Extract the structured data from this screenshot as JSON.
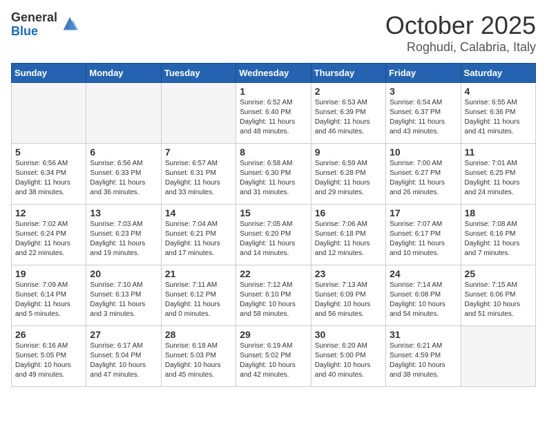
{
  "header": {
    "logo_general": "General",
    "logo_blue": "Blue",
    "month_title": "October 2025",
    "location": "Roghudi, Calabria, Italy"
  },
  "weekdays": [
    "Sunday",
    "Monday",
    "Tuesday",
    "Wednesday",
    "Thursday",
    "Friday",
    "Saturday"
  ],
  "weeks": [
    [
      {
        "day": "",
        "empty": true
      },
      {
        "day": "",
        "empty": true
      },
      {
        "day": "",
        "empty": true
      },
      {
        "day": "1",
        "sunrise": "6:52 AM",
        "sunset": "6:40 PM",
        "daylight": "11 hours and 48 minutes."
      },
      {
        "day": "2",
        "sunrise": "6:53 AM",
        "sunset": "6:39 PM",
        "daylight": "11 hours and 46 minutes."
      },
      {
        "day": "3",
        "sunrise": "6:54 AM",
        "sunset": "6:37 PM",
        "daylight": "11 hours and 43 minutes."
      },
      {
        "day": "4",
        "sunrise": "6:55 AM",
        "sunset": "6:36 PM",
        "daylight": "11 hours and 41 minutes."
      }
    ],
    [
      {
        "day": "5",
        "sunrise": "6:56 AM",
        "sunset": "6:34 PM",
        "daylight": "11 hours and 38 minutes."
      },
      {
        "day": "6",
        "sunrise": "6:56 AM",
        "sunset": "6:33 PM",
        "daylight": "11 hours and 36 minutes."
      },
      {
        "day": "7",
        "sunrise": "6:57 AM",
        "sunset": "6:31 PM",
        "daylight": "11 hours and 33 minutes."
      },
      {
        "day": "8",
        "sunrise": "6:58 AM",
        "sunset": "6:30 PM",
        "daylight": "11 hours and 31 minutes."
      },
      {
        "day": "9",
        "sunrise": "6:59 AM",
        "sunset": "6:28 PM",
        "daylight": "11 hours and 29 minutes."
      },
      {
        "day": "10",
        "sunrise": "7:00 AM",
        "sunset": "6:27 PM",
        "daylight": "11 hours and 26 minutes."
      },
      {
        "day": "11",
        "sunrise": "7:01 AM",
        "sunset": "6:25 PM",
        "daylight": "11 hours and 24 minutes."
      }
    ],
    [
      {
        "day": "12",
        "sunrise": "7:02 AM",
        "sunset": "6:24 PM",
        "daylight": "11 hours and 22 minutes."
      },
      {
        "day": "13",
        "sunrise": "7:03 AM",
        "sunset": "6:23 PM",
        "daylight": "11 hours and 19 minutes."
      },
      {
        "day": "14",
        "sunrise": "7:04 AM",
        "sunset": "6:21 PM",
        "daylight": "11 hours and 17 minutes."
      },
      {
        "day": "15",
        "sunrise": "7:05 AM",
        "sunset": "6:20 PM",
        "daylight": "11 hours and 14 minutes."
      },
      {
        "day": "16",
        "sunrise": "7:06 AM",
        "sunset": "6:18 PM",
        "daylight": "11 hours and 12 minutes."
      },
      {
        "day": "17",
        "sunrise": "7:07 AM",
        "sunset": "6:17 PM",
        "daylight": "11 hours and 10 minutes."
      },
      {
        "day": "18",
        "sunrise": "7:08 AM",
        "sunset": "6:16 PM",
        "daylight": "11 hours and 7 minutes."
      }
    ],
    [
      {
        "day": "19",
        "sunrise": "7:09 AM",
        "sunset": "6:14 PM",
        "daylight": "11 hours and 5 minutes."
      },
      {
        "day": "20",
        "sunrise": "7:10 AM",
        "sunset": "6:13 PM",
        "daylight": "11 hours and 3 minutes."
      },
      {
        "day": "21",
        "sunrise": "7:11 AM",
        "sunset": "6:12 PM",
        "daylight": "11 hours and 0 minutes."
      },
      {
        "day": "22",
        "sunrise": "7:12 AM",
        "sunset": "6:10 PM",
        "daylight": "10 hours and 58 minutes."
      },
      {
        "day": "23",
        "sunrise": "7:13 AM",
        "sunset": "6:09 PM",
        "daylight": "10 hours and 56 minutes."
      },
      {
        "day": "24",
        "sunrise": "7:14 AM",
        "sunset": "6:08 PM",
        "daylight": "10 hours and 54 minutes."
      },
      {
        "day": "25",
        "sunrise": "7:15 AM",
        "sunset": "6:06 PM",
        "daylight": "10 hours and 51 minutes."
      }
    ],
    [
      {
        "day": "26",
        "sunrise": "6:16 AM",
        "sunset": "5:05 PM",
        "daylight": "10 hours and 49 minutes."
      },
      {
        "day": "27",
        "sunrise": "6:17 AM",
        "sunset": "5:04 PM",
        "daylight": "10 hours and 47 minutes."
      },
      {
        "day": "28",
        "sunrise": "6:18 AM",
        "sunset": "5:03 PM",
        "daylight": "10 hours and 45 minutes."
      },
      {
        "day": "29",
        "sunrise": "6:19 AM",
        "sunset": "5:02 PM",
        "daylight": "10 hours and 42 minutes."
      },
      {
        "day": "30",
        "sunrise": "6:20 AM",
        "sunset": "5:00 PM",
        "daylight": "10 hours and 40 minutes."
      },
      {
        "day": "31",
        "sunrise": "6:21 AM",
        "sunset": "4:59 PM",
        "daylight": "10 hours and 38 minutes."
      },
      {
        "day": "",
        "empty": true
      }
    ]
  ]
}
